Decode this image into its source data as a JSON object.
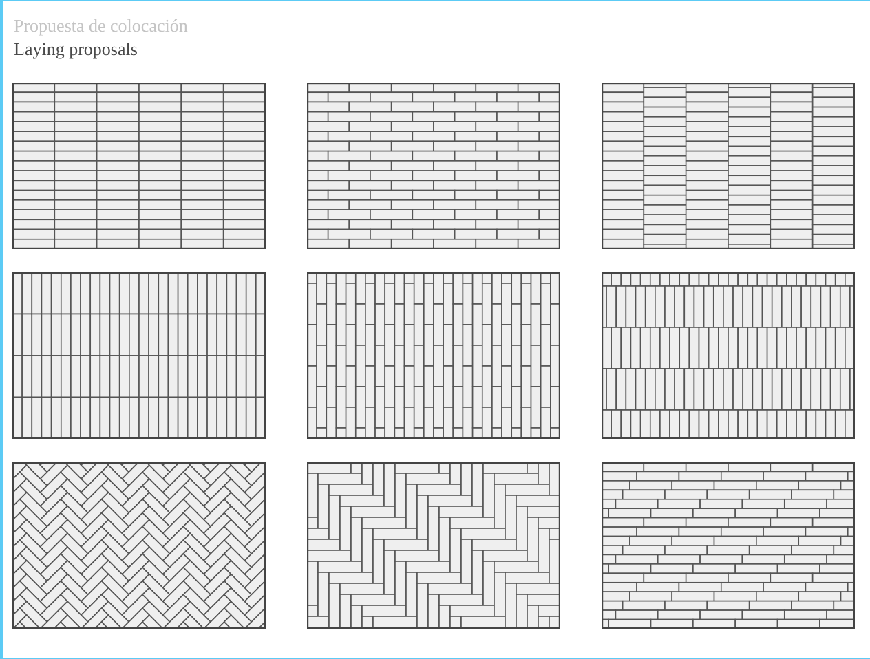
{
  "header": {
    "title": "Propuesta de colocación",
    "subtitle": "Laying proposals"
  },
  "patterns": [
    {
      "kind": "stack-bond"
    },
    {
      "kind": "brick-bond"
    },
    {
      "kind": "column-offset"
    },
    {
      "kind": "vertical-stack"
    },
    {
      "kind": "vertical-brick"
    },
    {
      "kind": "vertical-row-offset"
    },
    {
      "kind": "diagonal-herringbone"
    },
    {
      "kind": "herringbone"
    },
    {
      "kind": "third-offset"
    }
  ]
}
